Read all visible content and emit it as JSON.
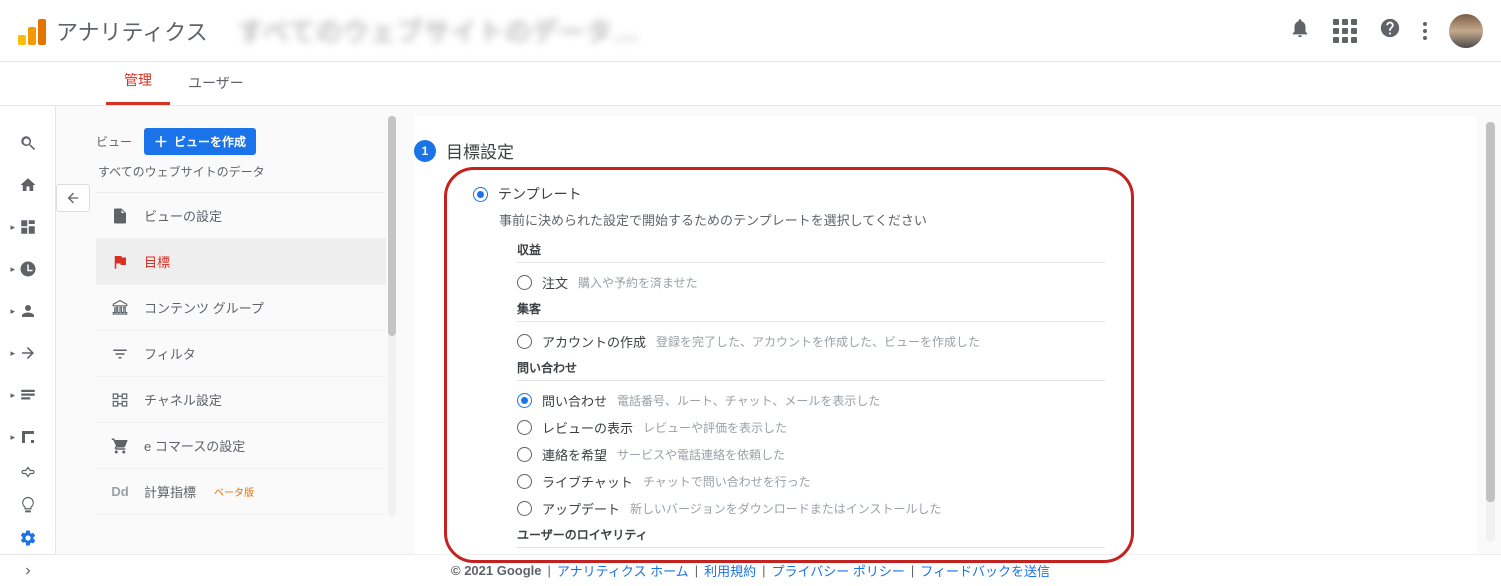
{
  "app_title": "アナリティクス",
  "blurred_header": "すべてのウェブサイトのデータ…",
  "tabs": {
    "admin": "管理",
    "user": "ユーザー"
  },
  "view_column": {
    "label": "ビュー",
    "create_btn": "ビューを作成",
    "view_name": "すべてのウェブサイトのデータ",
    "items": [
      {
        "label": "ビューの設定"
      },
      {
        "label": "目標"
      },
      {
        "label": "コンテンツ グループ"
      },
      {
        "label": "フィルタ"
      },
      {
        "label": "チャネル設定"
      },
      {
        "label": "e コマースの設定"
      },
      {
        "label": "計算指標",
        "beta": "ベータ版"
      }
    ]
  },
  "goal_setup": {
    "step_num": "1",
    "title": "目標設定",
    "template_label": "テンプレート",
    "template_desc": "事前に決められた設定で開始するためのテンプレートを選択してください",
    "groups": [
      {
        "title": "収益",
        "options": [
          {
            "name": "注文",
            "desc": "購入や予約を済ませた",
            "selected": false
          }
        ]
      },
      {
        "title": "集客",
        "options": [
          {
            "name": "アカウントの作成",
            "desc": "登録を完了した、アカウントを作成した、ビューを作成した",
            "selected": false
          }
        ]
      },
      {
        "title": "問い合わせ",
        "options": [
          {
            "name": "問い合わせ",
            "desc": "電話番号、ルート、チャット、メールを表示した",
            "selected": true
          },
          {
            "name": "レビューの表示",
            "desc": "レビューや評価を表示した",
            "selected": false
          },
          {
            "name": "連絡を希望",
            "desc": "サービスや電話連絡を依頼した",
            "selected": false
          },
          {
            "name": "ライブチャット",
            "desc": "チャットで問い合わせを行った",
            "selected": false
          },
          {
            "name": "アップデート",
            "desc": "新しいバージョンをダウンロードまたはインストールした",
            "selected": false
          }
        ]
      },
      {
        "title": "ユーザーのロイヤリティ",
        "options": []
      }
    ]
  },
  "footer": {
    "copyright": "© 2021 Google",
    "links": [
      "アナリティクス ホーム",
      "利用規約",
      "プライバシー ポリシー",
      "フィードバックを送信"
    ]
  }
}
